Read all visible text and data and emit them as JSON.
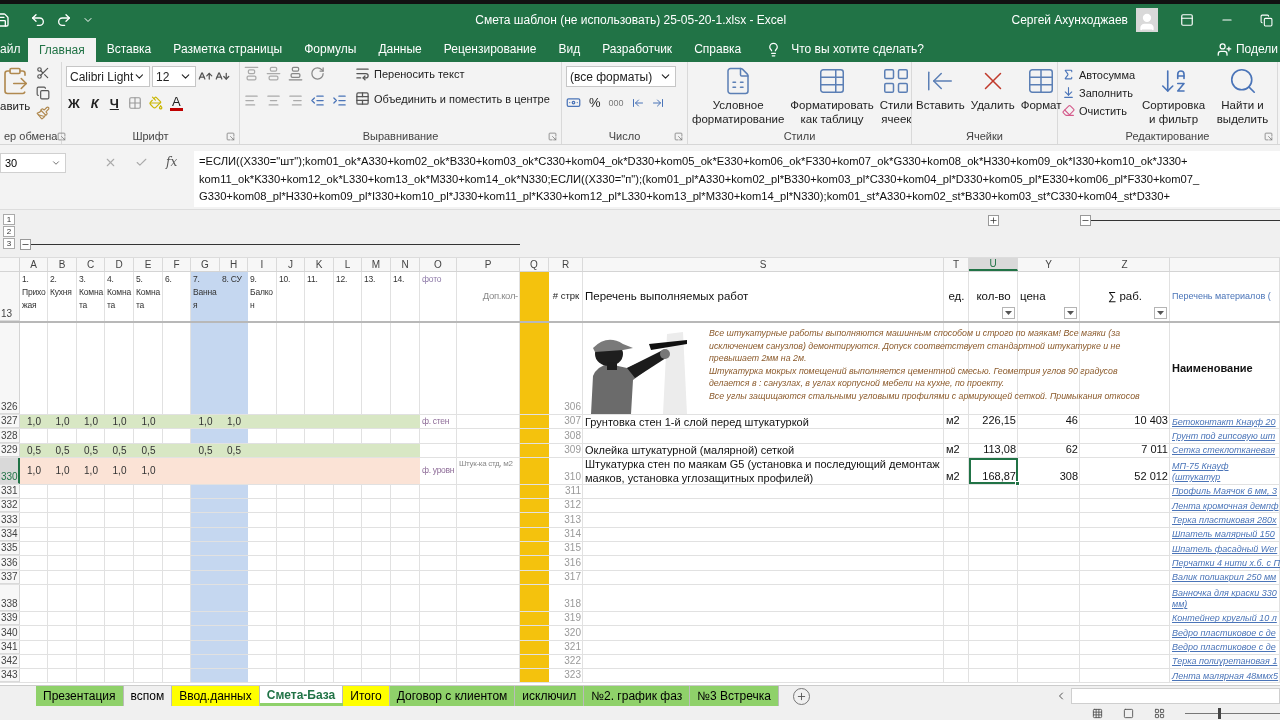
{
  "title_bar": {
    "title": "Смета шаблон (не использовать) 25-05-20-1.xlsx  -  Excel",
    "user": "Сергей Ахунходжаев"
  },
  "menu_tabs": [
    {
      "label": "айл",
      "selected": false
    },
    {
      "label": "Главная",
      "selected": true
    },
    {
      "label": "Вставка",
      "selected": false
    },
    {
      "label": "Разметка страницы",
      "selected": false
    },
    {
      "label": "Формулы",
      "selected": false
    },
    {
      "label": "Данные",
      "selected": false
    },
    {
      "label": "Рецензирование",
      "selected": false
    },
    {
      "label": "Вид",
      "selected": false
    },
    {
      "label": "Разработчик",
      "selected": false
    },
    {
      "label": "Справка",
      "selected": false
    }
  ],
  "tell_me": {
    "placeholder": "Что вы хотите сделать?"
  },
  "share": "Подели",
  "ribbon": [
    {
      "kind": "clipboard",
      "label": "ер обмена",
      "paste": "авить"
    },
    {
      "kind": "font",
      "label": "Шрифт",
      "font": "Calibri Light",
      "size": "12",
      "bold": "Ж",
      "italic": "К",
      "underline": "Ч",
      "font_color": "A"
    },
    {
      "kind": "alignment",
      "label": "Выравнивание",
      "wrap": "Переносить текст",
      "merge": "Объединить и поместить в центре"
    },
    {
      "kind": "number",
      "label": "Число",
      "format": "(все форматы)",
      "percent": "%",
      "thousands": "000"
    },
    {
      "kind": "styles",
      "label": "Стили",
      "buttons": [
        "Условное форматирование",
        "Форматировать как таблицу",
        "Стили ячеек"
      ]
    },
    {
      "kind": "cells",
      "label": "Ячейки",
      "buttons": [
        "Вставить",
        "Удалить",
        "Формат"
      ]
    },
    {
      "kind": "editing",
      "label": "Редактирование",
      "small": [
        "Автосумма",
        "Заполнить",
        "Очистить"
      ],
      "buttons": [
        "Сортировка и фильтр",
        "Найти и выделить"
      ]
    }
  ],
  "formula_bar": {
    "name_box": "30",
    "fx": "fx",
    "lines": [
      "=ЕСЛИ((X330=\"шт\");kom01_ok*A330+kom02_ok*B330+kom03_ok*C330+kom04_ok*D330+kom05_ok*E330+kom06_ok*F330+kom07_ok*G330+kom08_ok*H330+kom09_ok*I330+kom10_ok*J330+",
      "kom11_ok*K330+kom12_ok*L330+kom13_ok*M330+kom14_ok*N330;ЕСЛИ((X330=\"п\");(kom01_pl*A330+kom02_pl*B330+kom03_pl*C330+kom04_pl*D330+kom05_pl*E330+kom06_pl*F330+kom07_",
      "G330+kom08_pl*H330+kom09_pl*I330+kom10_pl*J330+kom11_pl*K330+kom12_pl*L330+kom13_pl*M330+kom14_pl*N330);kom01_st*A330+kom02_st*B330+kom03_st*C330+kom04_st*D330+"
    ]
  },
  "outline": {
    "levels": [
      "1",
      "2",
      "3"
    ],
    "groups": [
      {
        "expanded": true
      },
      {
        "expanded": false
      },
      {
        "expanded": true
      }
    ]
  },
  "columns": [
    {
      "label": "A",
      "selected": false
    },
    {
      "label": "B",
      "selected": false
    },
    {
      "label": "C",
      "selected": false
    },
    {
      "label": "D",
      "selected": false
    },
    {
      "label": "E",
      "selected": false
    },
    {
      "label": "F",
      "selected": false
    },
    {
      "label": "G",
      "selected": false,
      "color": "#c5d7f0"
    },
    {
      "label": "H",
      "selected": false,
      "color": "#c5d7f0"
    },
    {
      "label": "I",
      "selected": false
    },
    {
      "label": "J",
      "selected": false
    },
    {
      "label": "K",
      "selected": false
    },
    {
      "label": "L",
      "selected": false
    },
    {
      "label": "M",
      "selected": false
    },
    {
      "label": "N",
      "selected": false
    },
    {
      "label": "O",
      "selected": false
    },
    {
      "label": "P",
      "selected": false
    },
    {
      "label": "Q",
      "selected": false,
      "color": "#f4c20d"
    },
    {
      "label": "R",
      "selected": false
    },
    {
      "label": "S",
      "selected": false
    },
    {
      "label": "T",
      "selected": false
    },
    {
      "label": "U",
      "selected": true
    },
    {
      "label": "Y",
      "selected": false
    },
    {
      "label": "Z",
      "selected": false
    },
    {
      "selected": false
    }
  ],
  "rows": [
    {
      "number": "13",
      "kind": "header",
      "selected": false,
      "cells": [
        "1. Прихожая",
        "2. Кухня",
        "3. Комната",
        "4. Комната",
        "5. Комната",
        "6.",
        "7. Ванная",
        "8. СУ",
        "9. Балкон",
        "10.",
        "11.",
        "12.",
        "13.",
        "14.",
        "фото",
        "Доп.кол-",
        null,
        "# стрк",
        "Перечень выполняемых работ",
        "ед.",
        {
          "text": "кол-во",
          "filter": true
        },
        {
          "text": "цена",
          "filter": true
        },
        {
          "text": "∑ раб.",
          "filter": true
        },
        "Перечень материалов ("
      ]
    },
    {
      "number": "326",
      "kind": "note",
      "selected": false,
      "cells": [
        null,
        null,
        null,
        null,
        null,
        null,
        null,
        null,
        null,
        null,
        null,
        null,
        null,
        null,
        null,
        null,
        null,
        "306",
        {
          "text": "Все штукатурные работы выполняются машинным способом и строго по маякам!  Все маяки (за исключением санузлов) демонтируются. Допуск соответствует стандартной штукатурке и не превышает 2мм на 2м.\nШтукатурка мокрых помещений выполняется цементной смесью. Геометрия углов 90 градусов делается в : санузлах, в углах корпусной мебели на кухне, по проекту.\nВсе углы защищаются стальными угловыми профилями с армирующей сеткой. Примыкания откосов"
        },
        null,
        null,
        null,
        null,
        {
          "text": "Наименование",
          "kind": "heading"
        }
      ]
    },
    {
      "number": "327",
      "kind": "line",
      "selected": false,
      "color": "#d8e7c4",
      "cells": [
        "1,0",
        "1,0",
        "1,0",
        "1,0",
        "1,0",
        null,
        "1,0",
        "1,0",
        null,
        null,
        null,
        null,
        null,
        null,
        "ф. стен",
        null,
        null,
        "307",
        "Грунтовка стен 1-й слой перед штукатуркой",
        "м2",
        "226,15",
        "46",
        "10 403",
        {
          "text": "Бетоконтакт Кнауф 20",
          "kind": "link"
        }
      ]
    },
    {
      "number": "328",
      "kind": "line",
      "selected": false,
      "cells": [
        null,
        null,
        null,
        null,
        null,
        null,
        null,
        null,
        null,
        null,
        null,
        null,
        null,
        null,
        null,
        null,
        null,
        "308",
        null,
        null,
        null,
        null,
        null,
        {
          "text": "Грунт под гипсовую шт",
          "kind": "link"
        }
      ]
    },
    {
      "number": "329",
      "kind": "line",
      "selected": false,
      "color": "#d8e7c4",
      "cells": [
        "0,5",
        "0,5",
        "0,5",
        "0,5",
        "0,5",
        null,
        "0,5",
        "0,5",
        null,
        null,
        null,
        null,
        null,
        null,
        null,
        null,
        null,
        "309",
        "Оклейка штукатурной (малярной) сеткой",
        "м2",
        "113,08",
        "62",
        "7 011",
        {
          "text": "Сетка стеклотканевая",
          "kind": "link"
        }
      ]
    },
    {
      "number": "330",
      "kind": "double",
      "selected": true,
      "color": "#fbe3d6",
      "cells": [
        "1,0",
        "1,0",
        "1,0",
        "1,0",
        "1,0",
        null,
        null,
        null,
        null,
        null,
        null,
        null,
        null,
        null,
        "ф. уровн",
        "Штук-ка стд, м2",
        null,
        "310",
        "Штукатурка стен по маякам G5 (установка и последующий демонтаж маяков, установка углозащитных профилей)",
        "м2",
        {
          "text": "168,87",
          "selected": true
        },
        "308",
        "52 012",
        {
          "text": "МП-75 Кнауф (штукатур",
          "kind": "link"
        }
      ]
    },
    {
      "number": "331",
      "kind": "line",
      "selected": false,
      "cells": [
        null,
        null,
        null,
        null,
        null,
        null,
        null,
        null,
        null,
        null,
        null,
        null,
        null,
        null,
        null,
        null,
        null,
        "311",
        null,
        null,
        null,
        null,
        null,
        {
          "text": "Профиль Маячок 6 мм, 3",
          "kind": "link"
        }
      ]
    },
    {
      "number": "332",
      "kind": "line",
      "selected": false,
      "cells": [
        null,
        null,
        null,
        null,
        null,
        null,
        null,
        null,
        null,
        null,
        null,
        null,
        null,
        null,
        null,
        null,
        null,
        "312",
        null,
        null,
        null,
        null,
        null,
        {
          "text": "Лента кромочная демпф",
          "kind": "link"
        }
      ]
    },
    {
      "number": "333",
      "kind": "line",
      "selected": false,
      "cells": [
        null,
        null,
        null,
        null,
        null,
        null,
        null,
        null,
        null,
        null,
        null,
        null,
        null,
        null,
        null,
        null,
        null,
        "313",
        null,
        null,
        null,
        null,
        null,
        {
          "text": "Терка пластиковая 280х",
          "kind": "link"
        }
      ]
    },
    {
      "number": "334",
      "kind": "line",
      "selected": false,
      "cells": [
        null,
        null,
        null,
        null,
        null,
        null,
        null,
        null,
        null,
        null,
        null,
        null,
        null,
        null,
        null,
        null,
        null,
        "314",
        null,
        null,
        null,
        null,
        null,
        {
          "text": "Шпатель малярный 150",
          "kind": "link"
        }
      ]
    },
    {
      "number": "335",
      "kind": "line",
      "selected": false,
      "cells": [
        null,
        null,
        null,
        null,
        null,
        null,
        null,
        null,
        null,
        null,
        null,
        null,
        null,
        null,
        null,
        null,
        null,
        "315",
        null,
        null,
        null,
        null,
        null,
        {
          "text": "Шпатель фасадный Wer",
          "kind": "link"
        }
      ]
    },
    {
      "number": "336",
      "kind": "line",
      "selected": false,
      "cells": [
        null,
        null,
        null,
        null,
        null,
        null,
        null,
        null,
        null,
        null,
        null,
        null,
        null,
        null,
        null,
        null,
        null,
        "316",
        null,
        null,
        null,
        null,
        null,
        {
          "text": "Перчатки 4 нити х.б. с П",
          "kind": "link"
        }
      ]
    },
    {
      "number": "337",
      "kind": "line",
      "selected": false,
      "cells": [
        null,
        null,
        null,
        null,
        null,
        null,
        null,
        null,
        null,
        null,
        null,
        null,
        null,
        null,
        null,
        null,
        null,
        "317",
        null,
        null,
        null,
        null,
        null,
        {
          "text": "Валик полиакрил 250 мм",
          "kind": "link"
        }
      ]
    },
    {
      "number": "338",
      "kind": "double",
      "selected": false,
      "cells": [
        null,
        null,
        null,
        null,
        null,
        null,
        null,
        null,
        null,
        null,
        null,
        null,
        null,
        null,
        null,
        null,
        null,
        "318",
        null,
        null,
        null,
        null,
        null,
        {
          "text": "Ванночка для краски 330 мм)",
          "kind": "link"
        }
      ]
    },
    {
      "number": "339",
      "kind": "line",
      "selected": false,
      "cells": [
        null,
        null,
        null,
        null,
        null,
        null,
        null,
        null,
        null,
        null,
        null,
        null,
        null,
        null,
        null,
        null,
        null,
        "319",
        null,
        null,
        null,
        null,
        null,
        {
          "text": "Контейнер круглый 10 л",
          "kind": "link"
        }
      ]
    },
    {
      "number": "340",
      "kind": "line",
      "selected": false,
      "cells": [
        null,
        null,
        null,
        null,
        null,
        null,
        null,
        null,
        null,
        null,
        null,
        null,
        null,
        null,
        null,
        null,
        null,
        "320",
        null,
        null,
        null,
        null,
        null,
        {
          "text": "Ведро пластиковое с де",
          "kind": "link"
        }
      ]
    },
    {
      "number": "341",
      "kind": "line",
      "selected": false,
      "cells": [
        null,
        null,
        null,
        null,
        null,
        null,
        null,
        null,
        null,
        null,
        null,
        null,
        null,
        null,
        null,
        null,
        null,
        "321",
        null,
        null,
        null,
        null,
        null,
        {
          "text": "Ведро пластиковое с де",
          "kind": "link"
        }
      ]
    },
    {
      "number": "342",
      "kind": "line",
      "selected": false,
      "cells": [
        null,
        null,
        null,
        null,
        null,
        null,
        null,
        null,
        null,
        null,
        null,
        null,
        null,
        null,
        null,
        null,
        null,
        "322",
        null,
        null,
        null,
        null,
        null,
        {
          "text": "Терка полиуретановая 1",
          "kind": "link"
        }
      ]
    },
    {
      "number": "343",
      "kind": "line",
      "selected": false,
      "cells": [
        null,
        null,
        null,
        null,
        null,
        null,
        null,
        null,
        null,
        null,
        null,
        null,
        null,
        null,
        null,
        null,
        null,
        "323",
        null,
        null,
        null,
        null,
        null,
        {
          "text": "Лента малярная 48ммх5",
          "kind": "link"
        }
      ]
    }
  ],
  "sheet_tabs": [
    {
      "label": "Презентация",
      "color": "#8fd16a",
      "selected": false
    },
    {
      "label": "вспом",
      "selected": false
    },
    {
      "label": "Ввод.данных",
      "color": "#ffff00",
      "selected": false
    },
    {
      "label": "Смета-База",
      "color": "#8fd16a",
      "selected": true
    },
    {
      "label": "Итого",
      "color": "#ffff00",
      "selected": false
    },
    {
      "label": "Договор с клиентом",
      "color": "#8fd16a",
      "selected": false
    },
    {
      "label": "исключил",
      "color": "#8fd16a",
      "selected": false
    },
    {
      "label": "№2. график фаз",
      "color": "#8fd16a",
      "selected": false
    },
    {
      "label": "№3 Встречка",
      "color": "#8fd16a",
      "selected": false
    }
  ],
  "status_bar": {
    "zoom": {
      "level": 0.35
    }
  }
}
